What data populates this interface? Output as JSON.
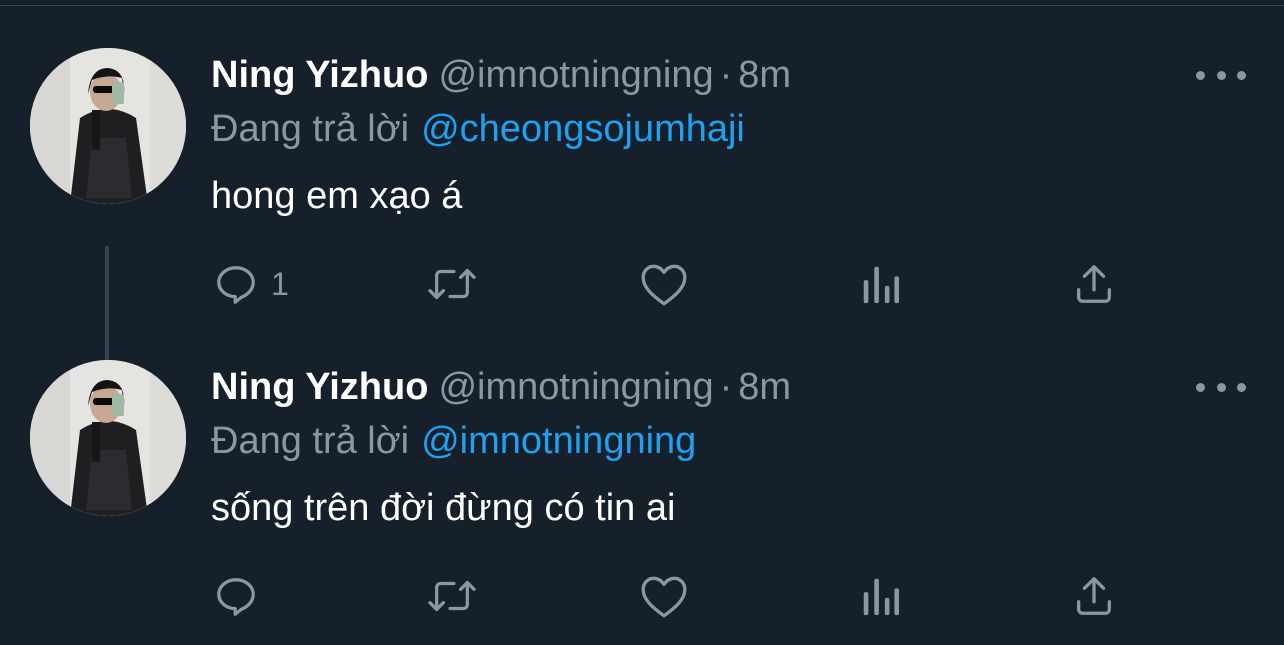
{
  "tweets": [
    {
      "author_name": "Ning Yizhuo",
      "handle": "@imnotningning",
      "separator": "·",
      "time": "8m",
      "reply_label": "Đang trả lời",
      "reply_to": "@cheongsojumhaji",
      "text": "hong em xạo á",
      "reply_count": "1"
    },
    {
      "author_name": "Ning Yizhuo",
      "handle": "@imnotningning",
      "separator": "·",
      "time": "8m",
      "reply_label": "Đang trả lời",
      "reply_to": "@imnotningning",
      "text": "sống trên đời đừng có tin ai",
      "reply_count": ""
    }
  ],
  "icons": {
    "reply": "reply-icon",
    "retweet": "retweet-icon",
    "like": "heart-icon",
    "analytics": "analytics-icon",
    "share": "share-icon",
    "more": "more-icon"
  },
  "colors": {
    "background": "#15202b",
    "text_primary": "#ffffff",
    "text_secondary": "#8899a6",
    "link": "#1da1f2",
    "divider": "#38444d"
  }
}
